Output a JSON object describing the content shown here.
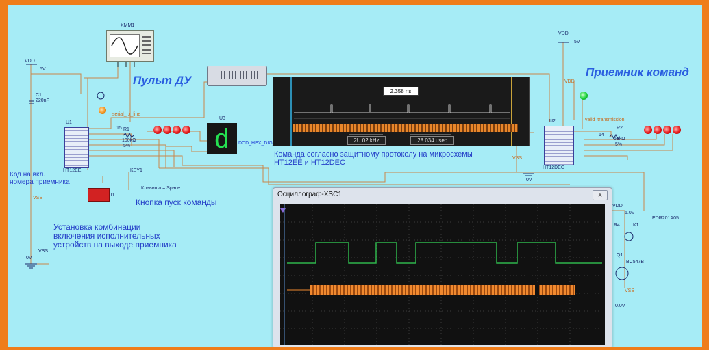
{
  "titles": {
    "remote": "Пульт ДУ",
    "receiver": "Приемник команд"
  },
  "instrument": {
    "ref": "XMM1"
  },
  "top_scope": {
    "cursor_time": "2.358 ns",
    "frequency": "2U.02 kHz",
    "time_diff": "28.034 usec"
  },
  "scope_window": {
    "title": "Осциллограф-XSC1",
    "close_label": "X"
  },
  "display": {
    "ref": "U3",
    "digit": "d",
    "part": "DCD_HEX_DIG_GREEN"
  },
  "encoder": {
    "ref": "U1",
    "part": "HT12EE"
  },
  "decoder": {
    "ref": "U2",
    "part": "HT12DEC"
  },
  "labels": {
    "vdd_left": "VDD",
    "v5_left": "5V",
    "c1": "C1",
    "c1_val": "220nF",
    "r1_num": "15",
    "r1": "R1",
    "r1_val": "100kΩ",
    "r1_tol": "5%",
    "serial_net": "serial_rx_line",
    "vss_left": "VSS",
    "v0_left": "0V",
    "vss_mid": "VSS",
    "key_ref": "J1",
    "key_label": "KEY1",
    "key_hint": "Клавиша = Space",
    "vdd_right": "VDD",
    "v5_right": "5V",
    "vdd_mid": "VDD",
    "valid_net": "valid_transmission",
    "r2_num": "14",
    "r2": "R2",
    "r2_val": "51kΩ",
    "r2_tol": "5%",
    "vss_right": "VSS",
    "v0_right": "0V",
    "vdd_relay": "VDD",
    "v5_relay": "5.0V",
    "relay_part": "EDR201A05",
    "k1": "K1",
    "r4": "R4",
    "q1": "Q1",
    "q1_part": "BC547B",
    "vss_relay": "VSS",
    "v0_relay": "0.0V"
  },
  "notes": {
    "code": [
      "Код на вкл.",
      "номера приемника"
    ],
    "button": "Кнопка пуск команды",
    "combination": [
      "Установка комбинации",
      "включения исполнительных",
      "устройств на выходе приемника"
    ],
    "protocol": [
      "Команда согласно защитному протоколу на микросхемы",
      "HT12EE и HT12DEC"
    ]
  }
}
